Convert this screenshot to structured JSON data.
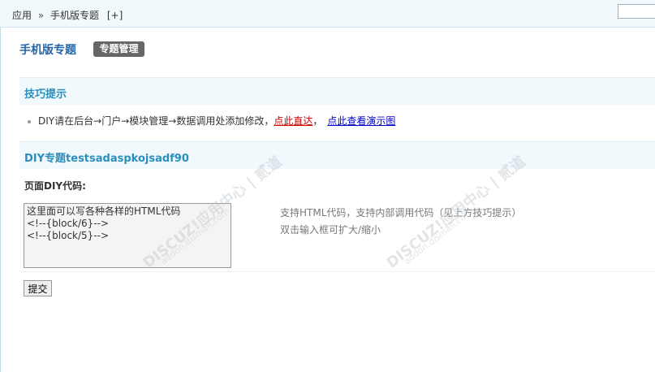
{
  "breadcrumb": {
    "items": [
      "应用",
      "手机版专题"
    ],
    "separator": "»",
    "add_label": "[+]"
  },
  "header": {
    "title": "手机版专题",
    "tab_label": "专题管理"
  },
  "tips_section": {
    "title": "技巧提示",
    "text": "DIY请在后台",
    "steps": [
      "门户",
      "模块管理",
      "数据调用处添加修改，"
    ],
    "arrow": "→",
    "link_direct": "点此直达",
    "comma": "，",
    "link_demo": "点此查看演示图"
  },
  "diy_section": {
    "title": "DIY专题testsadaspkojsadf90"
  },
  "code_field": {
    "label": "页面DIY代码:",
    "value": "这里面可以写各种各样的HTML代码\n<!--{block/6}-->\n<!--{block/5}-->",
    "help_line1": "支持HTML代码，支持内部调用代码（见上方技巧提示）",
    "help_line2": "双击输入框可扩大/缩小"
  },
  "submit_label": "提交",
  "watermark": {
    "brand": "DISCUZ!应用中心 | 贰道",
    "url": "addon.dismall.com"
  },
  "colors": {
    "title_blue": "#2366a8",
    "section_text": "#2a8fbd",
    "section_bg": "#f2f9fd",
    "tab_bg": "#666666",
    "link_red": "#cc0000",
    "link_blue": "#0000cc"
  }
}
